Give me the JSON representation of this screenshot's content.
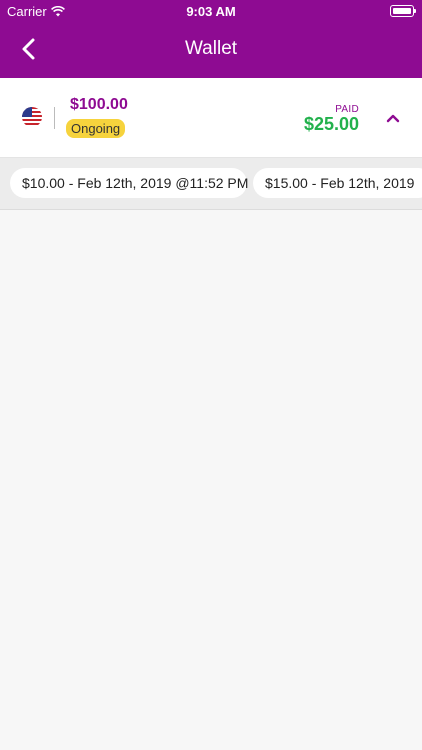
{
  "status_bar": {
    "carrier": "Carrier",
    "time": "9:03 AM"
  },
  "header": {
    "title": "Wallet"
  },
  "summary": {
    "amount": "$100.00",
    "status_badge": "Ongoing",
    "paid_label": "PAID",
    "paid_amount": "$25.00"
  },
  "payments": [
    {
      "label": "$10.00 - Feb 12th, 2019 @11:52 PM"
    },
    {
      "label": "$15.00 - Feb 12th, 2019"
    }
  ],
  "colors": {
    "brand": "#8e0b92",
    "paid": "#22b14c",
    "badge": "#f6d33d"
  }
}
